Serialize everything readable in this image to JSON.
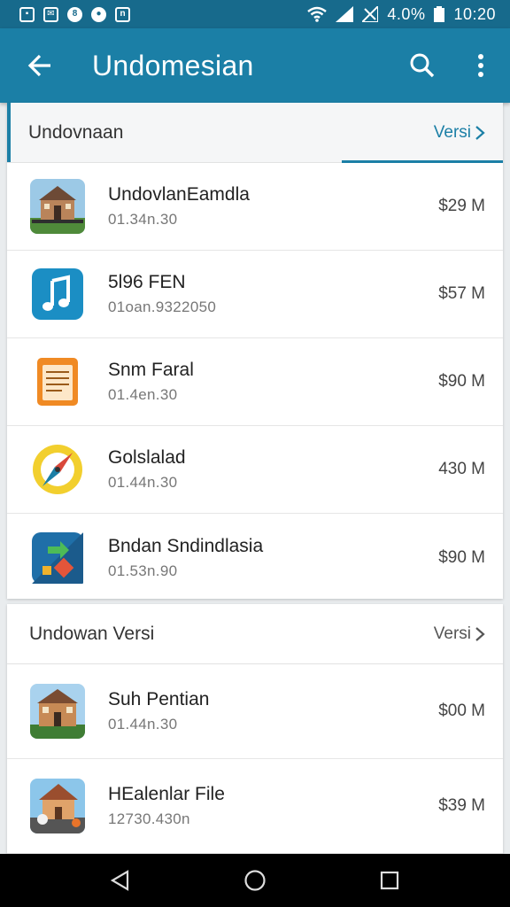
{
  "status_bar": {
    "icons_left": [
      "image-icon",
      "message-icon",
      "sync-icon",
      "record-icon",
      "notification-icon"
    ],
    "battery_text": "4.0%",
    "time": "10:20"
  },
  "app_bar": {
    "title": "Undomesian",
    "icons": [
      "back-arrow-icon",
      "search-icon",
      "more-vert-icon"
    ]
  },
  "section1": {
    "title": "Undovnaan",
    "link": "Versi",
    "items": [
      {
        "name": "UndovlanEamdla",
        "sub": "01.34n.30",
        "size": "$29 M",
        "icon": "building-photo-icon"
      },
      {
        "name": "5l96 FEN",
        "sub": "01oan.9322050",
        "size": "$57 M",
        "icon": "music-note-icon"
      },
      {
        "name": "Snm Faral",
        "sub": "01.4en.30",
        "size": "$90 M",
        "icon": "document-icon"
      },
      {
        "name": "Golslalad",
        "sub": "01.44n.30",
        "size": "430 M",
        "icon": "compass-icon"
      },
      {
        "name": "Bndan Sndindlasia",
        "sub": "01.53n.90",
        "size": "$90 M",
        "icon": "edit-tool-icon"
      }
    ]
  },
  "section2": {
    "title": "Undowan Versi",
    "link": "Versi",
    "items": [
      {
        "name": "Suh Pentian",
        "sub": "01.44n.30",
        "size": "$00 M",
        "icon": "building-photo-icon"
      },
      {
        "name": "HEalenlar File",
        "sub": "12730.430n",
        "size": "$39 M",
        "icon": "house-photo-icon"
      }
    ]
  },
  "colors": {
    "status_bar": "#176a8c",
    "app_bar": "#1b7fa6",
    "accent": "#1b7fa6"
  }
}
